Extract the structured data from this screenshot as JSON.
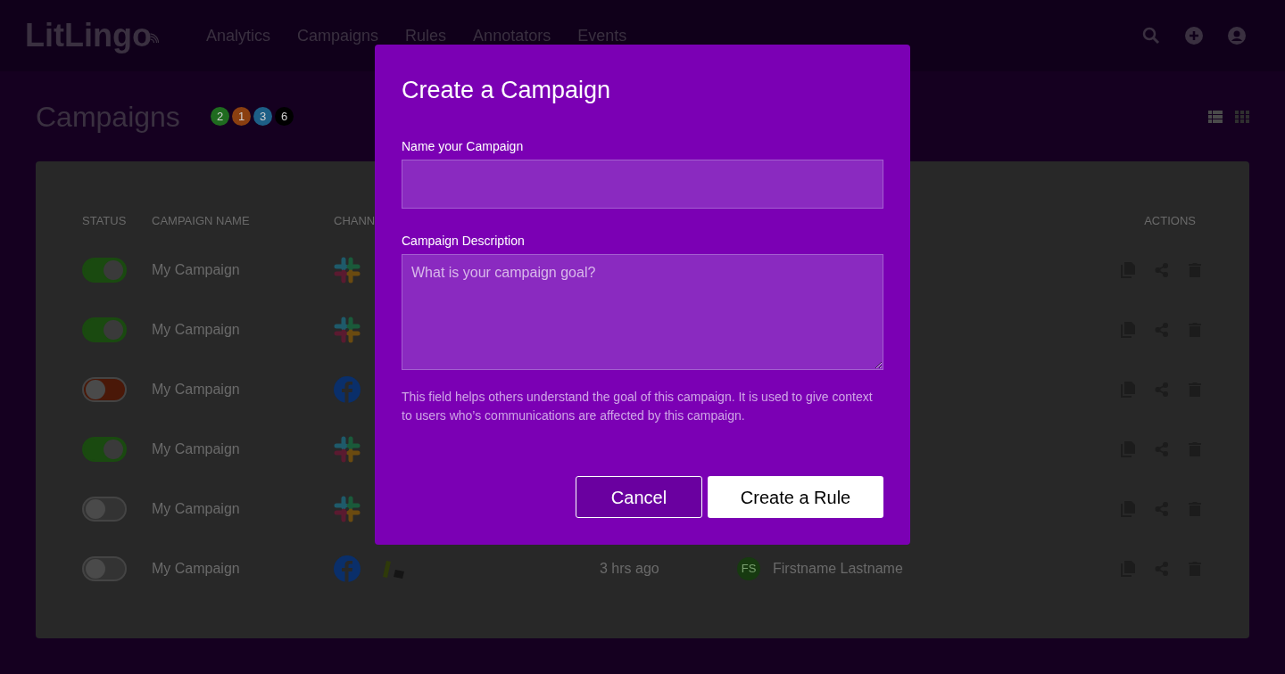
{
  "header": {
    "logo": "LitLingo",
    "nav": [
      {
        "label": "Analytics",
        "selected": false
      },
      {
        "label": "Campaigns",
        "selected": false
      },
      {
        "label": "Rules",
        "selected": false
      },
      {
        "label": "Annotators",
        "selected": false
      },
      {
        "label": "Events",
        "selected": false
      }
    ]
  },
  "page": {
    "title": "Campaigns",
    "counts": [
      {
        "label": "2",
        "color": "#1f6b1f"
      },
      {
        "label": "1",
        "color": "#8a3f10"
      },
      {
        "label": "3",
        "color": "#1d5f86"
      },
      {
        "label": "6",
        "color": "#000000"
      }
    ],
    "view": {
      "list_selected": true
    }
  },
  "table": {
    "columns": [
      {
        "label": "STATUS"
      },
      {
        "label": "CAMPAIGN NAME"
      },
      {
        "label": "CHANN"
      },
      {
        "label": "ACTIONS"
      }
    ],
    "rows": [
      {
        "on": true,
        "color": "#1a4a10",
        "name": "My Campaign",
        "channels": [
          {
            "kind": "hash"
          }
        ]
      },
      {
        "on": true,
        "color": "#1a4a10",
        "name": "My Campaign",
        "channels": [
          {
            "kind": "hash"
          }
        ]
      },
      {
        "on": false,
        "color": "#4a1808",
        "name": "My Campaign",
        "channels": [
          {
            "kind": "f"
          }
        ]
      },
      {
        "on": true,
        "color": "#1a4a10",
        "name": "My Campaign",
        "channels": [
          {
            "kind": "hash"
          }
        ]
      },
      {
        "on": false,
        "color": "#333333",
        "name": "My Campaign",
        "channels": [
          {
            "kind": "hash"
          }
        ]
      },
      {
        "on": false,
        "color": "#333333",
        "name": "My Campaign",
        "channels": [
          {
            "kind": "f"
          },
          {
            "kind": "blocks"
          }
        ],
        "time": "3 hrs ago",
        "owner_initials": "FS",
        "owner": "Firstname Lastname"
      }
    ]
  },
  "modal": {
    "title": "Create a Campaign",
    "name_label": "Name your Campaign",
    "description_label": "Campaign Description",
    "description_placeholder": "What is your campaign goal?",
    "help": "This field helps others understand the goal of this campaign. It is used to give context to users who’s communications are affected by this campaign.",
    "buttons": [
      {
        "label": "Cancel",
        "kind": "secondary"
      },
      {
        "label": "Create a Rule",
        "kind": "primary"
      }
    ]
  }
}
